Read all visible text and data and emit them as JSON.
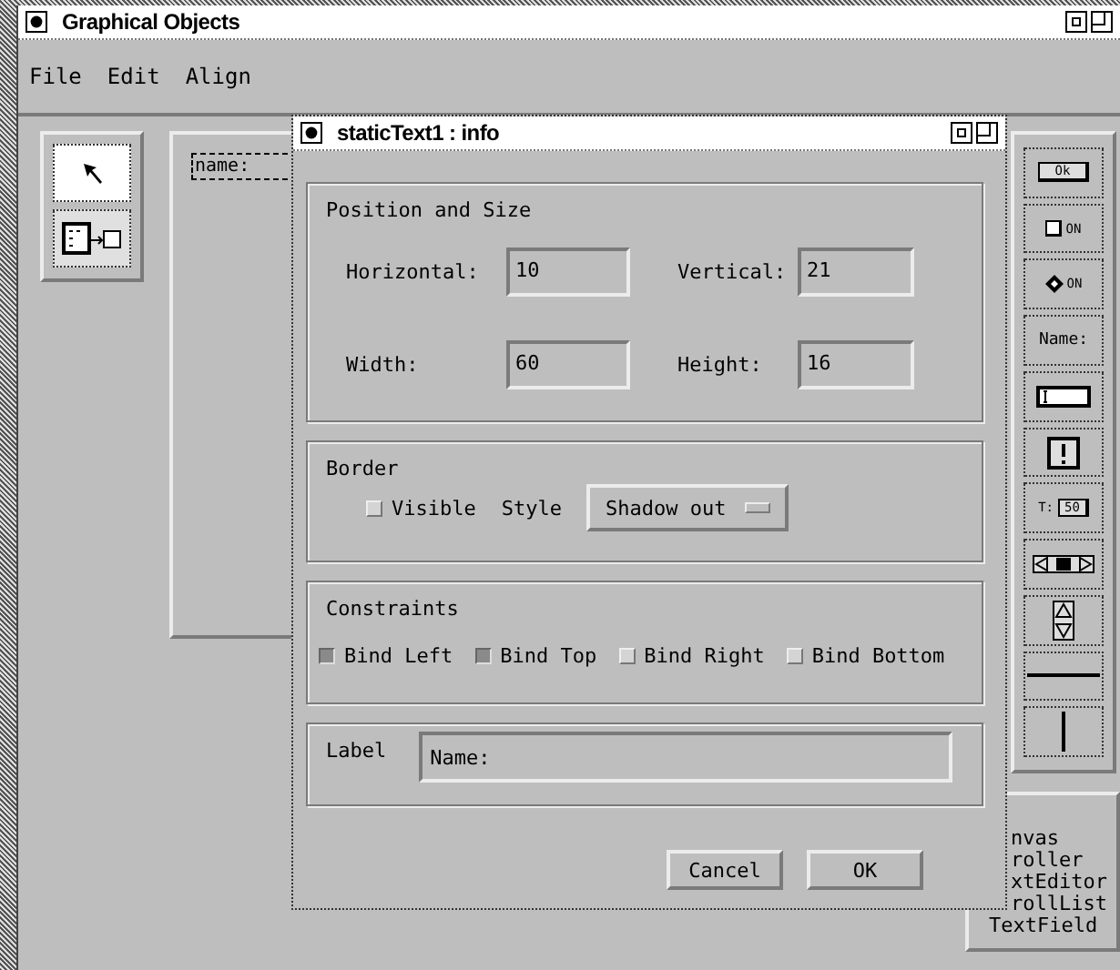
{
  "main_window": {
    "title": "Graphical Objects"
  },
  "menu": [
    {
      "label": "File"
    },
    {
      "label": "Edit"
    },
    {
      "label": "Align"
    }
  ],
  "tool_palette": [
    {
      "kind": "pointer",
      "selected": true
    },
    {
      "kind": "connect",
      "selected": false
    }
  ],
  "canvas": {
    "items": [
      {
        "text": "name:",
        "selected": true
      }
    ]
  },
  "widget_palette": [
    {
      "kind": "button",
      "text": "Ok"
    },
    {
      "kind": "checkbox",
      "text": "ON"
    },
    {
      "kind": "radio",
      "text": "ON"
    },
    {
      "kind": "label",
      "text": "Name:"
    },
    {
      "kind": "textfield"
    },
    {
      "kind": "alert"
    },
    {
      "kind": "spin",
      "text": "T:",
      "value": "50"
    },
    {
      "kind": "hscroll"
    },
    {
      "kind": "vscroll"
    },
    {
      "kind": "hline"
    },
    {
      "kind": "vline"
    }
  ],
  "widget_list": [
    {
      "text": "nvas",
      "covered": true
    },
    {
      "text": "roller",
      "covered": true
    },
    {
      "text": "xtEditor",
      "covered": true
    },
    {
      "text": "rollList",
      "covered": true
    },
    {
      "text": "TextField",
      "covered": false
    }
  ],
  "dialog": {
    "title": "staticText1 : info",
    "position_size": {
      "title": "Position and Size",
      "fields": [
        {
          "label": "Horizontal:",
          "value": "10"
        },
        {
          "label": "Vertical:",
          "value": "21"
        },
        {
          "label": "Width:",
          "value": "60"
        },
        {
          "label": "Height:",
          "value": "16"
        }
      ]
    },
    "border": {
      "title": "Border",
      "visible": {
        "label": "Visible",
        "checked": false
      },
      "style_label": "Style",
      "style_value": "Shadow out"
    },
    "constraints": {
      "title": "Constraints",
      "items": [
        {
          "label": "Bind Left",
          "checked": true
        },
        {
          "label": "Bind Top",
          "checked": true
        },
        {
          "label": "Bind Right",
          "checked": false
        },
        {
          "label": "Bind Bottom",
          "checked": false
        }
      ]
    },
    "label": {
      "title": "Label",
      "value": "Name:"
    },
    "buttons": [
      {
        "label": "Cancel"
      },
      {
        "label": "OK"
      }
    ]
  }
}
